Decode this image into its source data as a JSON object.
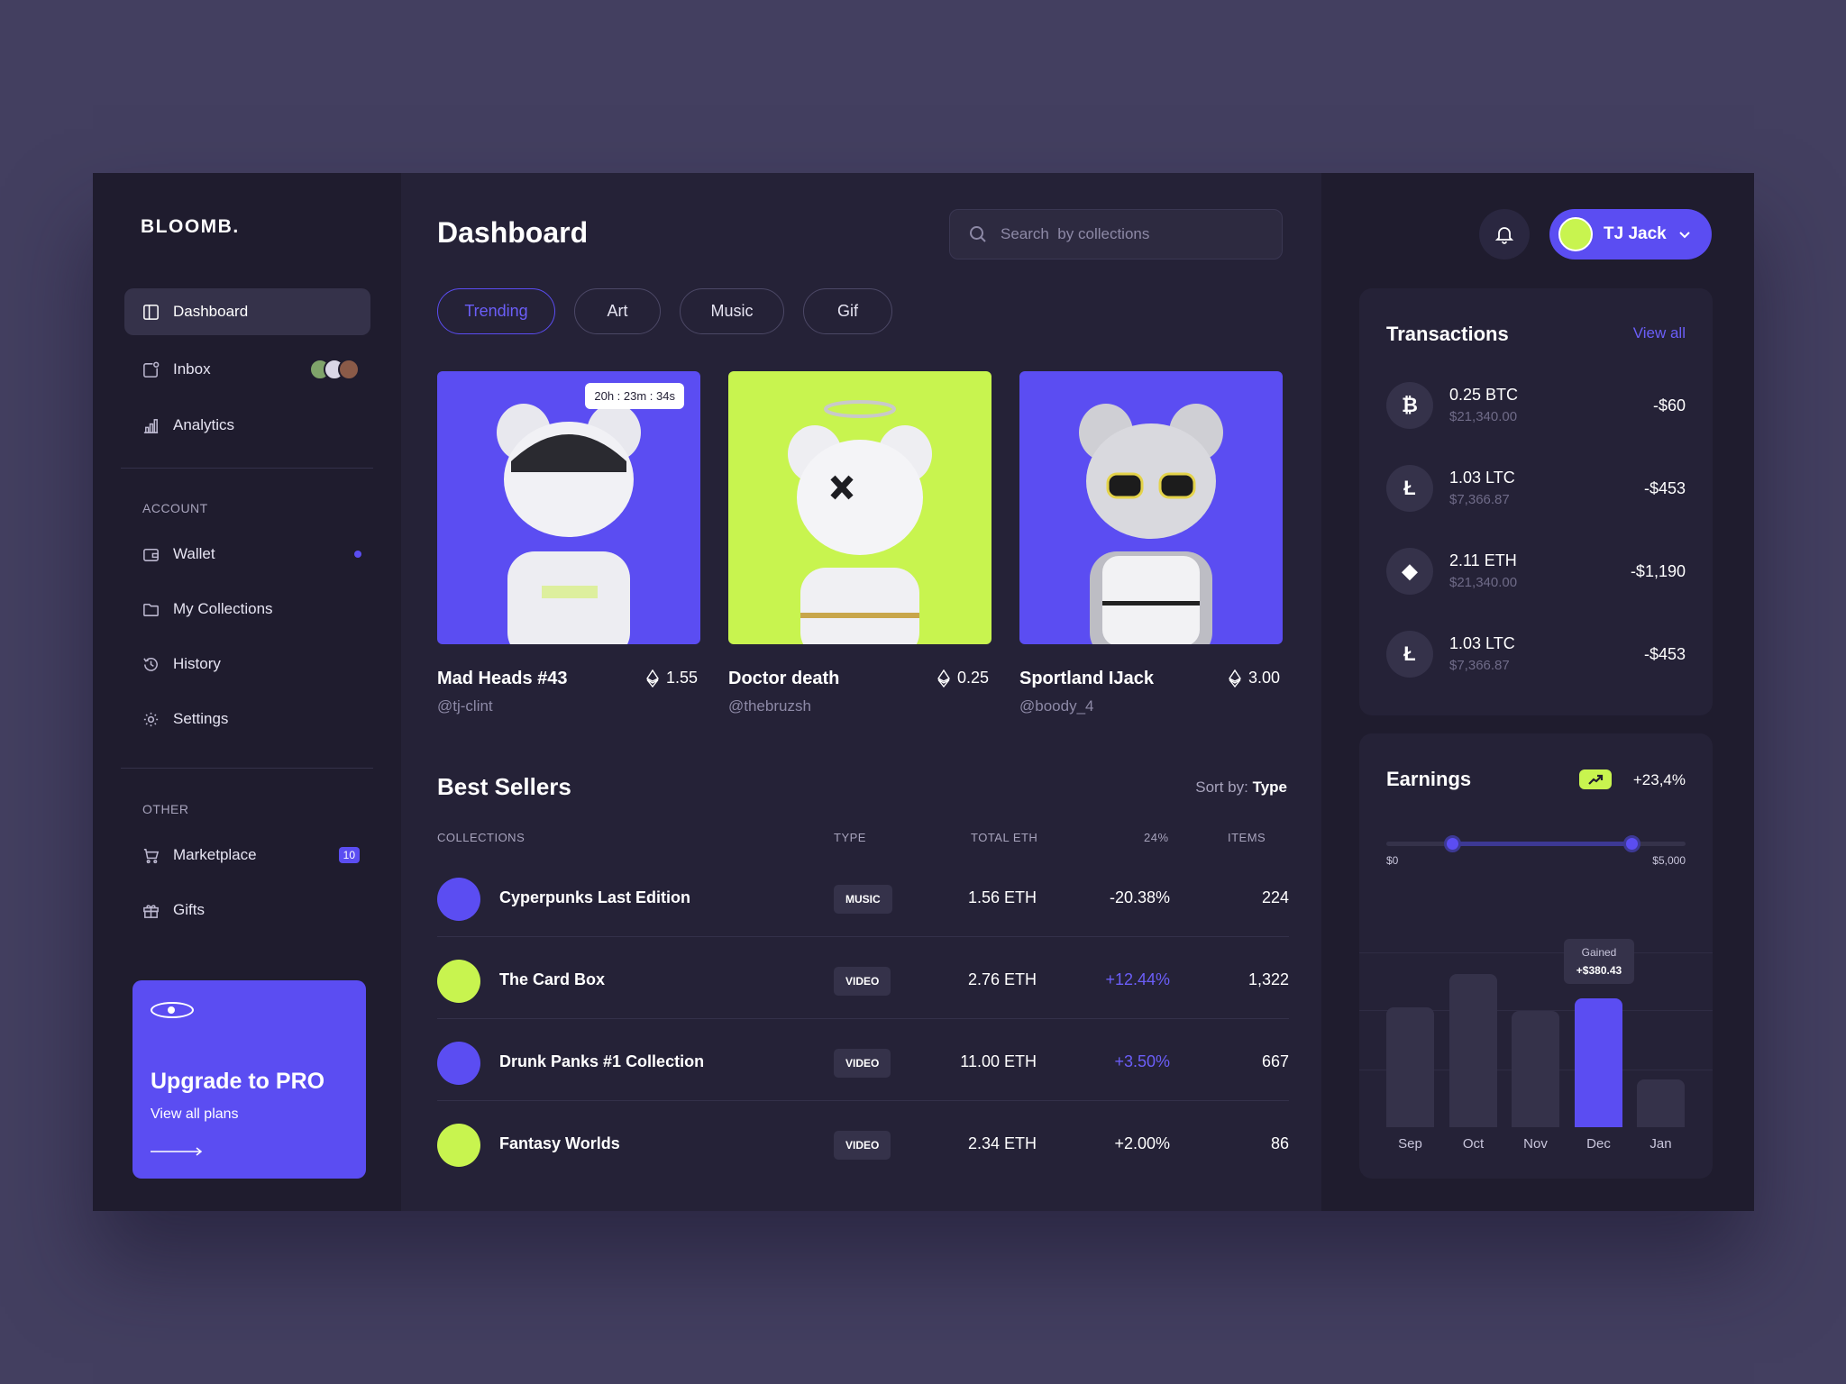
{
  "sidebar": {
    "logo": "BLOOMB.",
    "nav": [
      {
        "label": "Dashboard",
        "icon": "panel-icon"
      },
      {
        "label": "Inbox",
        "icon": "inbox-icon"
      },
      {
        "label": "Analytics",
        "icon": "bar-chart-icon"
      }
    ],
    "account_label": "ACCOUNT",
    "account": [
      {
        "label": "Wallet",
        "icon": "wallet-icon"
      },
      {
        "label": "My Collections",
        "icon": "folder-icon"
      },
      {
        "label": "History",
        "icon": "history-icon"
      },
      {
        "label": "Settings",
        "icon": "gear-icon"
      }
    ],
    "other_label": "OTHER",
    "other": [
      {
        "label": "Marketplace",
        "icon": "cart-icon",
        "badge": "10"
      },
      {
        "label": "Gifts",
        "icon": "gift-icon"
      }
    ],
    "promo": {
      "title": "Upgrade to PRO",
      "subtitle": "View all plans"
    }
  },
  "main": {
    "title": "Dashboard",
    "search_placeholder": "Search  by collections",
    "tabs": [
      "Trending",
      "Art",
      "Music",
      "Gif"
    ],
    "cards": [
      {
        "title": "Mad Heads #43",
        "price": "1.55",
        "handle": "@tj-clint",
        "timer": "20h : 23m : 34s",
        "bg": "#5b4df2"
      },
      {
        "title": "Doctor death",
        "price": "0.25",
        "handle": "@thebruzsh",
        "bg": "#c8f44f"
      },
      {
        "title": "Sportland IJack",
        "price": "3.00",
        "handle": "@boody_4",
        "bg": "#5b4df2"
      }
    ],
    "best_sellers": {
      "title": "Best Sellers",
      "sort_label": "Sort by:",
      "sort_value": "Type",
      "headers": [
        "COLLECTIONS",
        "TYPE",
        "TOTAL ETH",
        "24%",
        "ITEMS"
      ],
      "rows": [
        {
          "name": "Cyperpunks Last Edition",
          "type": "MUSIC",
          "eth": "1.56 ETH",
          "pct": "-20.38%",
          "items": "224",
          "avatar": "#5b4df2"
        },
        {
          "name": "The Card Box",
          "type": "VIDEO",
          "eth": "2.76 ETH",
          "pct": "+12.44%",
          "items": "1,322",
          "avatar": "#c8f44f"
        },
        {
          "name": "Drunk Panks #1 Collection",
          "type": "VIDEO",
          "eth": "11.00 ETH",
          "pct": "+3.50%",
          "items": "667",
          "avatar": "#5b4df2"
        },
        {
          "name": "Fantasy Worlds",
          "type": "VIDEO",
          "eth": "2.34 ETH",
          "pct": "+2.00%",
          "items": "86",
          "avatar": "#c8f44f"
        }
      ]
    }
  },
  "header": {
    "user_name": "TJ Jack"
  },
  "transactions": {
    "title": "Transactions",
    "view_all": "View all",
    "items": [
      {
        "symbol": "₿",
        "amount": "0.25 BTC",
        "usd": "$21,340.00",
        "change": "-$60"
      },
      {
        "symbol": "Ł",
        "amount": "1.03 LTC",
        "usd": "$7,366.87",
        "change": "-$453"
      },
      {
        "symbol": "◆",
        "amount": "2.11 ETH",
        "usd": "$21,340.00",
        "change": "-$1,190"
      },
      {
        "symbol": "Ł",
        "amount": "1.03 LTC",
        "usd": "$7,366.87",
        "change": "-$453"
      }
    ]
  },
  "earnings": {
    "title": "Earnings",
    "change": "+23,4%",
    "range_min": "$0",
    "range_max": "$5,000",
    "range_low_fraction": 0.22,
    "range_high_fraction": 0.82,
    "tooltip_label": "Gained",
    "tooltip_value": "+$380.43",
    "months": [
      "Sep",
      "Oct",
      "Nov",
      "Dec",
      "Jan"
    ],
    "values": [
      0.58,
      0.74,
      0.56,
      0.62,
      0.23
    ],
    "highlight_index": 3
  }
}
